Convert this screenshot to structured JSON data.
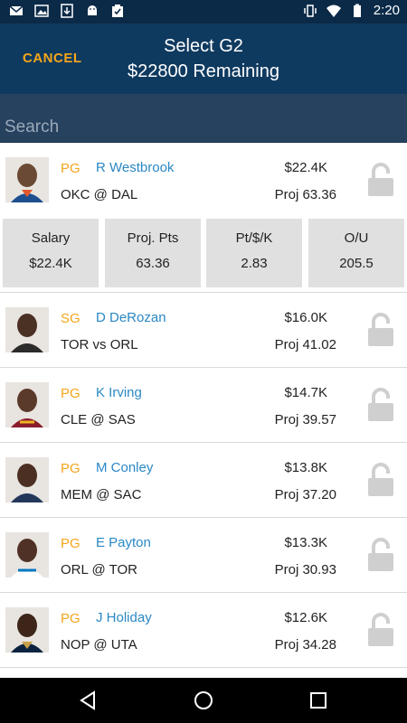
{
  "status_bar": {
    "time": "2:20",
    "left_icons": [
      "mail-icon",
      "image-icon",
      "download-icon",
      "android-icon",
      "clipboard-check-icon"
    ],
    "right_icons": [
      "vibrate-icon",
      "wifi-icon",
      "battery-icon"
    ]
  },
  "header": {
    "cancel_label": "CANCEL",
    "title_line1": "Select G2",
    "title_line2": "$22800 Remaining"
  },
  "search": {
    "placeholder": "Search"
  },
  "colors": {
    "header_bg": "#0f3a60",
    "accent_orange": "#f5a51b",
    "name_blue": "#2a88c5"
  },
  "players": [
    {
      "position": "PG",
      "name": "R Westbrook",
      "game": "OKC @ DAL",
      "salary": "$22.4K",
      "proj": "Proj 63.36",
      "expanded": true
    },
    {
      "position": "SG",
      "name": "D DeRozan",
      "game": "TOR vs ORL",
      "salary": "$16.0K",
      "proj": "Proj 41.02"
    },
    {
      "position": "PG",
      "name": "K Irving",
      "game": "CLE @ SAS",
      "salary": "$14.7K",
      "proj": "Proj 39.57"
    },
    {
      "position": "PG",
      "name": "M Conley",
      "game": "MEM @ SAC",
      "salary": "$13.8K",
      "proj": "Proj 37.20"
    },
    {
      "position": "PG",
      "name": "E Payton",
      "game": "ORL @ TOR",
      "salary": "$13.3K",
      "proj": "Proj 30.93"
    },
    {
      "position": "PG",
      "name": "J Holiday",
      "game": "NOP @ UTA",
      "salary": "$12.6K",
      "proj": "Proj 34.28"
    }
  ],
  "detail": {
    "stats": [
      {
        "label": "Salary",
        "value": "$22.4K"
      },
      {
        "label": "Proj. Pts",
        "value": "63.36"
      },
      {
        "label": "Pt/$/K",
        "value": "2.83"
      },
      {
        "label": "O/U",
        "value": "205.5"
      }
    ]
  },
  "nav_bar": {
    "buttons": [
      "back-icon",
      "home-icon",
      "recents-icon"
    ]
  }
}
